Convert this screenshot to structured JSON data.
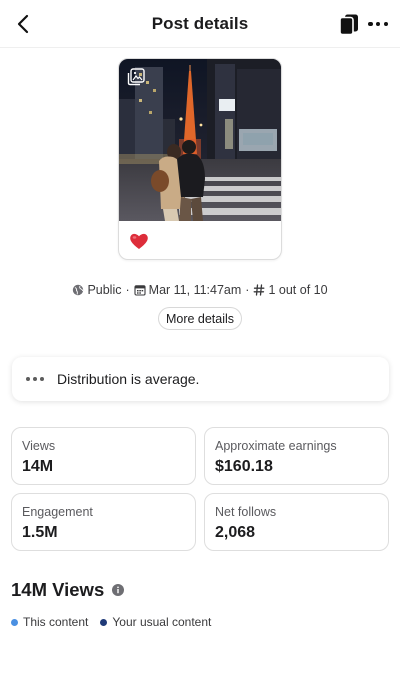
{
  "header": {
    "title": "Post details",
    "back_icon": "chevron-left-icon",
    "switch_icon": "switch-view-icon",
    "more_icon": "more-horizontal-icon"
  },
  "post": {
    "carousel_icon": "gallery-icon",
    "reaction_icon": "heart-emoji",
    "reaction_color": "#e0245e"
  },
  "meta": {
    "visibility_icon": "globe-icon",
    "visibility": "Public",
    "date_icon": "calendar-icon",
    "date": "Mar 11, 11:47am",
    "rank_icon": "hashtag-icon",
    "rank": "1 out of 10",
    "separator": "·"
  },
  "more_details_label": "More details",
  "distribution": {
    "icon": "more-horizontal-icon",
    "text": "Distribution is average."
  },
  "stats": [
    {
      "label": "Views",
      "value": "14M"
    },
    {
      "label": "Approximate earnings",
      "value": "$160.18"
    },
    {
      "label": "Engagement",
      "value": "1.5M"
    },
    {
      "label": "Net follows",
      "value": "2,068"
    }
  ],
  "views_section": {
    "title": "14M Views",
    "info_icon": "info-icon",
    "legend": [
      {
        "label": "This content",
        "color": "#4a90e2"
      },
      {
        "label": "Your usual content",
        "color": "#1f3a78"
      }
    ]
  }
}
